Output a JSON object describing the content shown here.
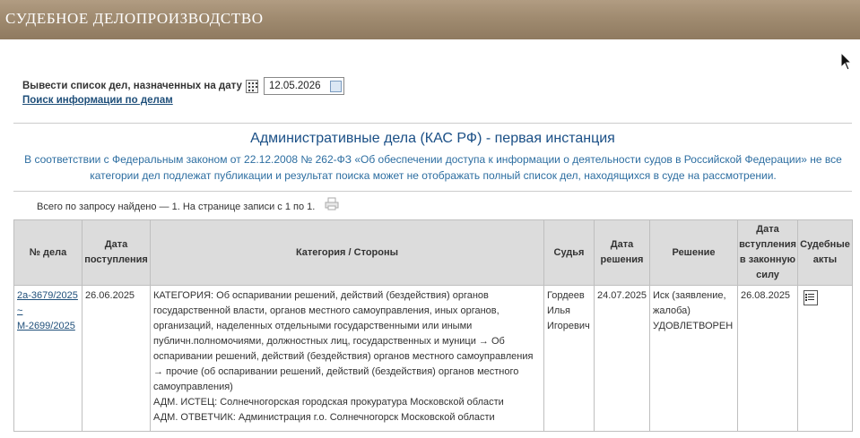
{
  "banner": {
    "title": "СУДЕБНОЕ ДЕЛОПРОИЗВОДСТВО"
  },
  "date_filter": {
    "label": "Вывести список дел, назначенных на дату",
    "value": "12.05.2026"
  },
  "search_link": "Поиск информации по делам",
  "section": {
    "title": "Административные дела (КАС РФ) - первая инстанция",
    "notice": "В соответствии с Федеральным законом от 22.12.2008 № 262-ФЗ «Об обеспечении доступа к информации о деятельности судов в Российской Федерации» не все категории дел подлежат публикации и результат поиска может не отображать полный список дел, находящихся в суде на рассмотрении."
  },
  "results_count": "Всего по запросу найдено — 1. На странице записи с 1 по 1.",
  "table": {
    "headers": [
      "№ дела",
      "Дата поступления",
      "Категория / Стороны",
      "Судья",
      "Дата решения",
      "Решение",
      "Дата вступления в законную силу",
      "Судебные акты"
    ],
    "rows": [
      {
        "case_number_main": "2а-3679/2025",
        "case_number_sep": "~",
        "case_number_alt": "М-2699/2025",
        "received": "26.06.2025",
        "category": "КАТЕГОРИЯ: Об оспаривании решений, действий (бездействия) органов государственной власти, органов местного самоуправления, иных органов, организаций, наделенных отдельными государственными или иными публичн.полномочиями, должностных лиц, государственных и муници → Об оспаривании решений, действий (бездействия) органов местного самоуправления → прочие (об оспаривании решений, действий (бездействия) органов местного самоуправления)",
        "plaintiff": "АДМ. ИСТЕЦ: Солнечногорская городская прокуратура Московской области",
        "defendant": "АДМ. ОТВЕТЧИК: Администрация г.о. Солнечногорск Московской области",
        "judge": "Гордеев Илья Игоревич",
        "decision_date": "24.07.2025",
        "decision": "Иск (заявление, жалоба) УДОВЛЕТВОРЕН",
        "effective_date": "26.08.2025",
        "acts_icon": "document-icon"
      }
    ]
  },
  "colors": {
    "banner": "#a08b70",
    "link": "#1f4f7a",
    "title": "#1a4f86",
    "notice": "#2d6ea1",
    "header_bg": "#dcdcdc"
  }
}
